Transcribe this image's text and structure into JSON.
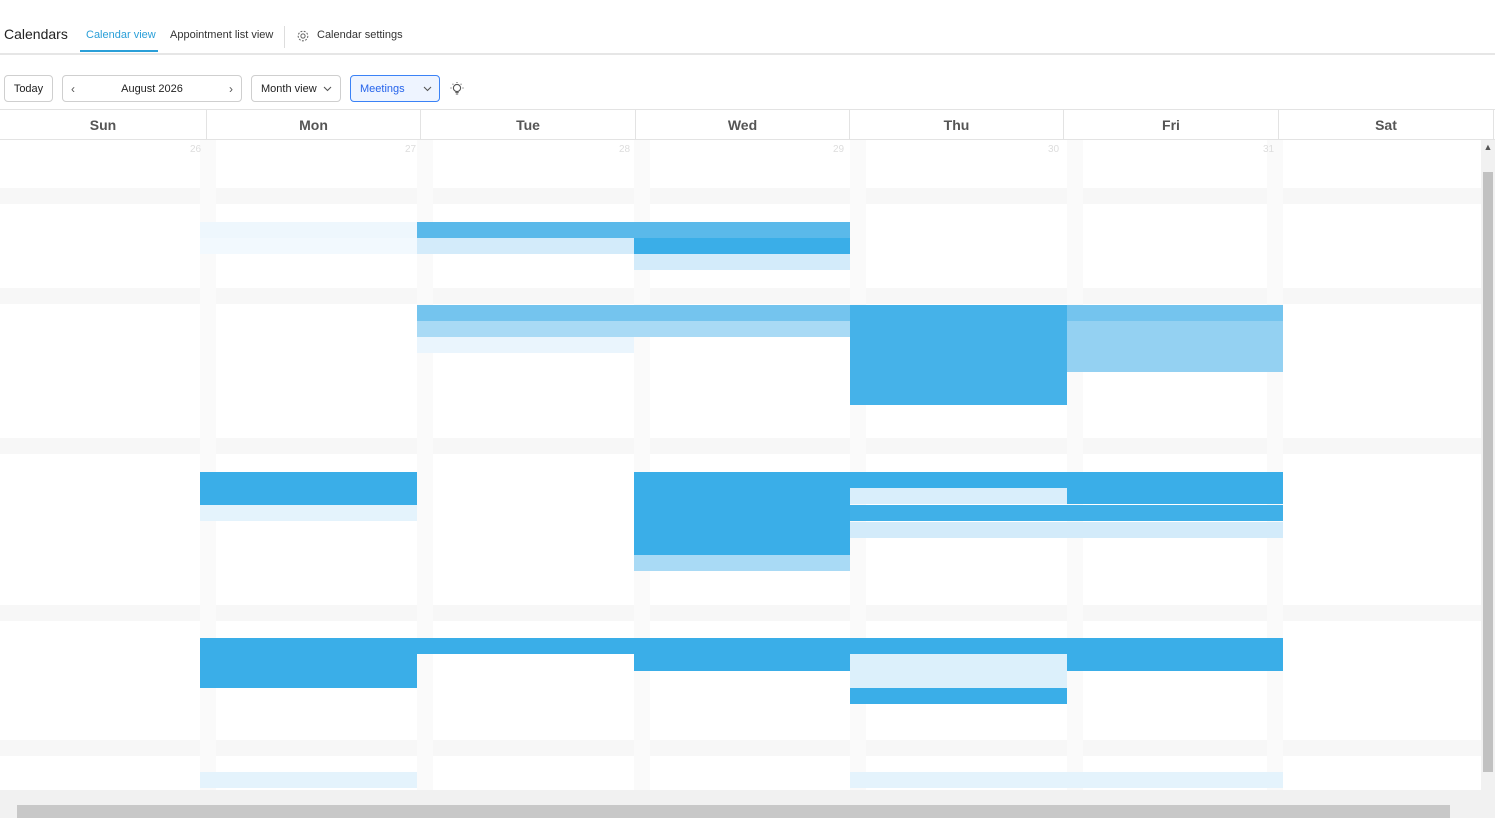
{
  "header": {
    "title": "Calendars",
    "tabs": [
      {
        "label": "Calendar view"
      },
      {
        "label": "Appointment list view"
      },
      {
        "label": "Calendar settings"
      }
    ]
  },
  "toolbar": {
    "today_label": "Today",
    "period_label": "August 2026",
    "view_select": "Month view",
    "calendar_select": "Meetings"
  },
  "weekdays": [
    "Sun",
    "Mon",
    "Tue",
    "Wed",
    "Thu",
    "Fri",
    "Sat"
  ],
  "first_row_day_numbers": [
    "26",
    "27",
    "28",
    "29",
    "30",
    "31"
  ],
  "colors": {
    "accent": "#2a9fd8",
    "event": "#3aaee8",
    "event_light": "#cfe9fa"
  }
}
